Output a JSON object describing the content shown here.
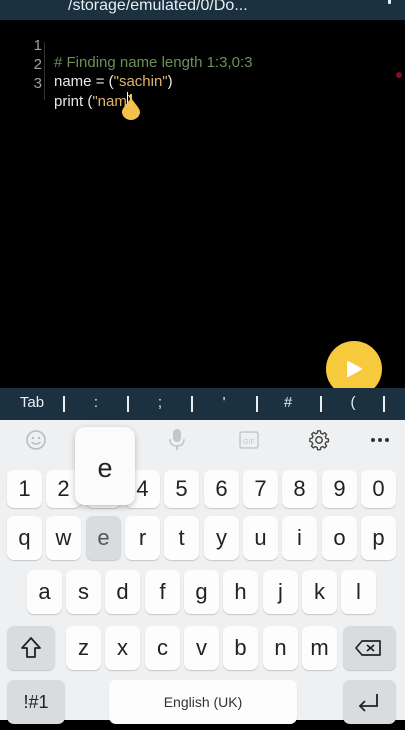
{
  "header": {
    "path": "/storage/emulated/0/Do..."
  },
  "editor": {
    "lines": [
      {
        "num": "1",
        "text": "# Finding name length 1:3,0:3"
      },
      {
        "num": "2",
        "prefix": "name = (",
        "string": "\"sachin\"",
        "suffix": ")"
      },
      {
        "num": "3",
        "prefix": "print (",
        "string": "\"nam",
        "suffix": ")"
      }
    ]
  },
  "tab_bar": {
    "keys": [
      "Tab",
      ":",
      ";",
      "'",
      "#",
      "("
    ]
  },
  "toolbar": {
    "icons": [
      "emoji-icon",
      "mic-icon",
      "gif-icon",
      "gear-icon",
      "more-icon"
    ]
  },
  "keyboard": {
    "popup_key": "e",
    "row_numbers": [
      "1",
      "2",
      "3",
      "4",
      "5",
      "6",
      "7",
      "8",
      "9",
      "0"
    ],
    "row_q": [
      "q",
      "w",
      "e",
      "r",
      "t",
      "y",
      "u",
      "i",
      "o",
      "p"
    ],
    "row_a": [
      "a",
      "s",
      "d",
      "f",
      "g",
      "h",
      "j",
      "k",
      "l"
    ],
    "row_z": [
      "z",
      "x",
      "c",
      "v",
      "b",
      "n",
      "m"
    ],
    "symbols_label": "!#1",
    "space_label": "English (UK)"
  },
  "colors": {
    "accent_run": "#f7c93c",
    "bar": "#1c3140",
    "comment": "#6c8f5a",
    "string": "#e0b46a"
  }
}
